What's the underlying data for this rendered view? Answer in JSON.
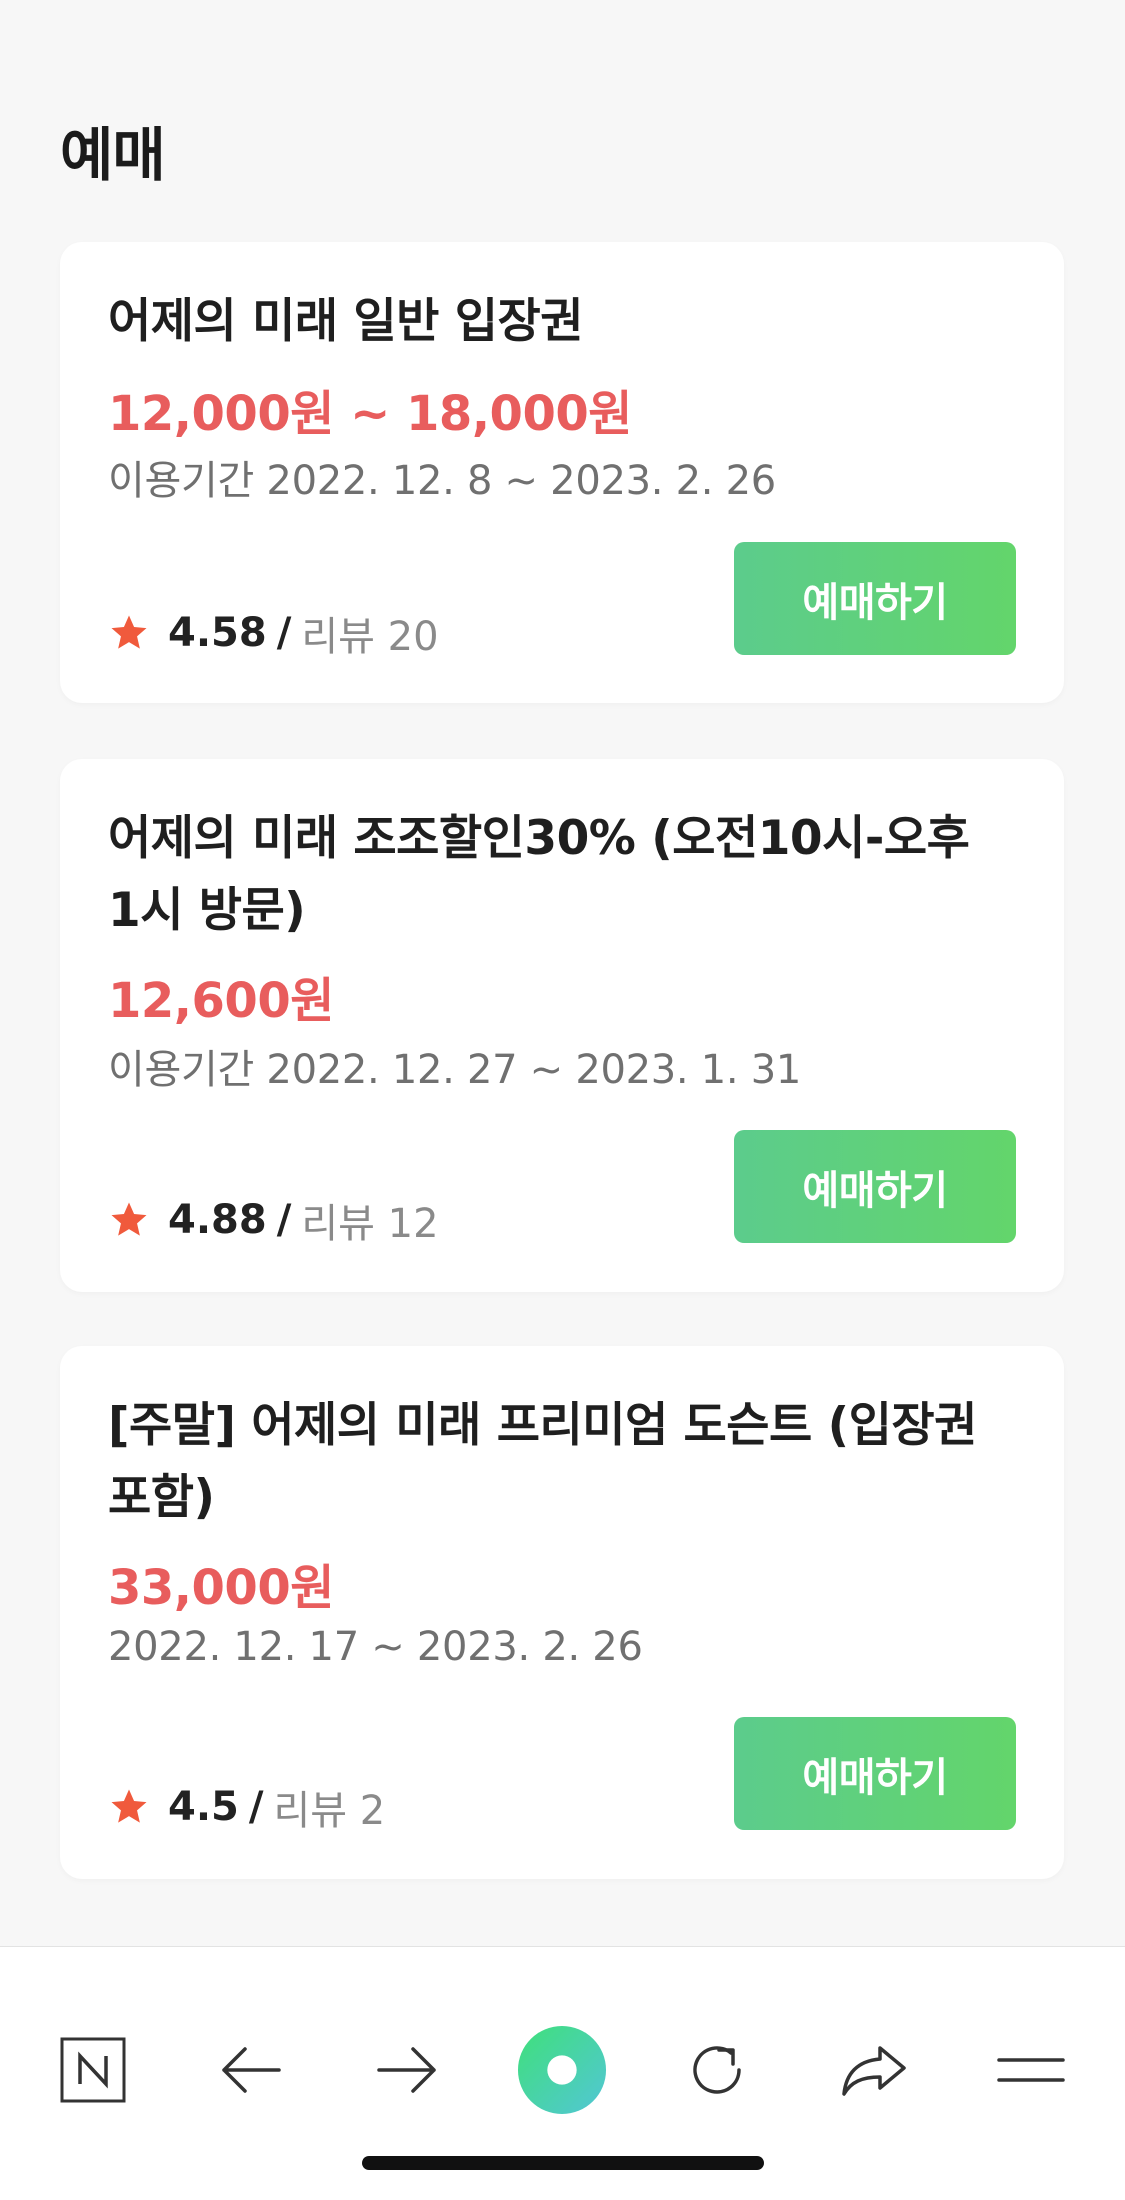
{
  "section_title": "예매",
  "tickets": [
    {
      "title": "어제의 미래 일반 입장권",
      "price": "12,000원 ~ 18,000원",
      "period": "이용기간 2022. 12. 8 ~ 2023. 2. 26",
      "rating": "4.58",
      "separator": "/",
      "review": "리뷰 20",
      "button": "예매하기"
    },
    {
      "title": "어제의 미래 조조할인30% (오전10시-오후1시 방문)",
      "price": "12,600원",
      "period": "이용기간 2022. 12. 27 ~ 2023. 1. 31",
      "rating": "4.88",
      "separator": "/",
      "review": "리뷰 12",
      "button": "예매하기"
    },
    {
      "title": "[주말] 어제의 미래 프리미엄 도슨트 (입장권 포함)",
      "price": "33,000원",
      "period": "2022. 12. 17 ~ 2023. 2. 26",
      "rating": "4.5",
      "separator": "/",
      "review": "리뷰 2",
      "button": "예매하기"
    }
  ],
  "toolbar": {
    "icons": [
      "naver-home-icon",
      "back-arrow-icon",
      "forward-arrow-icon",
      "green-dot-icon",
      "refresh-icon",
      "share-icon",
      "menu-icon"
    ]
  },
  "colors": {
    "price": "#e85d5d",
    "button_start": "#5ccc8c",
    "button_end": "#63d56b",
    "star": "#f05a3c"
  }
}
